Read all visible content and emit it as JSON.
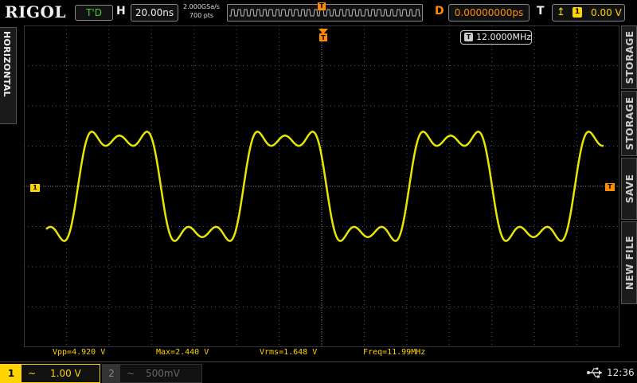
{
  "top_bar": {
    "brand": "RIGOL",
    "run_status": "T'D",
    "horizontal_letter": "H",
    "timebase": "20.00ns",
    "sample_rate": "2.000GSa/s",
    "memory_depth": "700 pts",
    "delay_letter": "D",
    "delay_value": "0.00000000ps",
    "trigger_letter": "T",
    "trigger_source": "1",
    "trigger_level": "0.00 V",
    "trigger_edge_icon": "rising-edge-icon"
  },
  "left_panel": {
    "label": "HORIZONTAL"
  },
  "screen": {
    "frequency_counter": "12.0000MHz",
    "counter_marker": "T",
    "ch1_ground_marker": "1",
    "trigger_level_marker": "T",
    "trace_color": "#e6e600"
  },
  "right_menu": {
    "items": [
      "STORAGE",
      "STORAGE",
      "SAVE",
      "NEW FILE"
    ]
  },
  "measurements": {
    "vpp": "Vpp=4.920 V",
    "max": "Max=2.440 V",
    "vrms": "Vrms=1.648 V",
    "freq": "Freq=11.99MHz"
  },
  "bottom_bar": {
    "ch1": {
      "number": "1",
      "coupling": "~",
      "scale": "1.00 V"
    },
    "ch2": {
      "number": "2",
      "coupling": "~",
      "scale": "500mV"
    },
    "usb_icon": "usb-icon",
    "time": "12:36"
  },
  "colors": {
    "ch1": "#ffd400",
    "trigger": "#ff8c00",
    "run_status": "#3ccf3c"
  }
}
